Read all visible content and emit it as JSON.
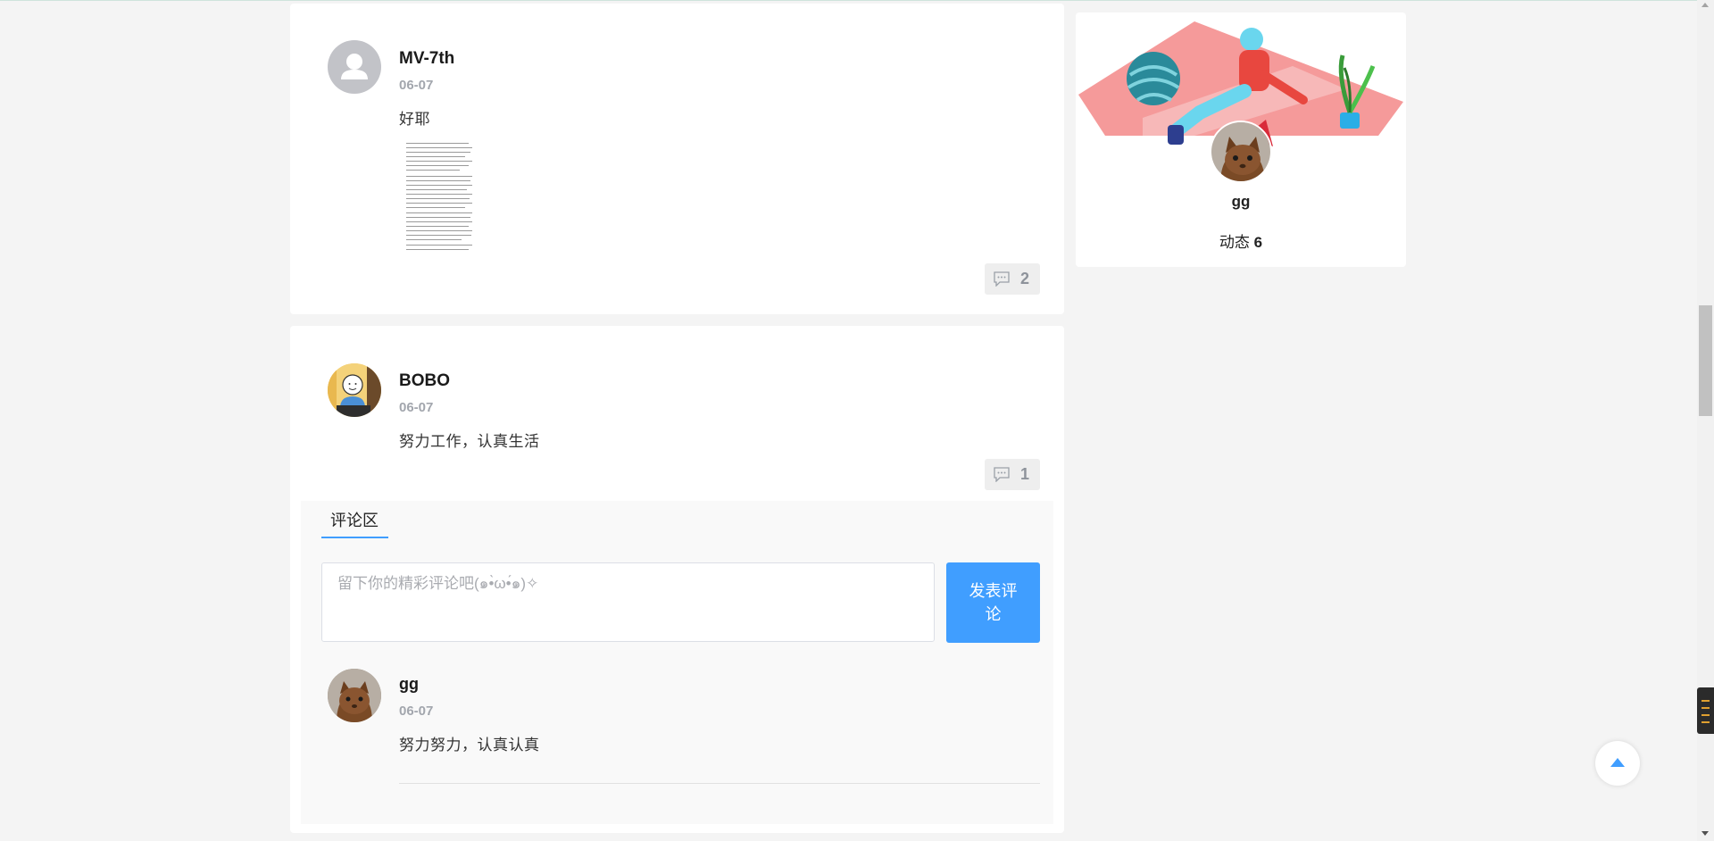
{
  "feed": {
    "posts": [
      {
        "author": "MV-7th",
        "date": "06-07",
        "text": "好耶",
        "comment_count": "2",
        "avatar_icon": "default-user-icon",
        "has_image": true
      },
      {
        "author": "BOBO",
        "date": "06-07",
        "text": "努力工作，认真生活",
        "comment_count": "1",
        "avatar_icon": "cartoon-avatar"
      }
    ]
  },
  "comment_section": {
    "tab_label": "评论区",
    "input_placeholder": "留下你的精彩评论吧(๑•̀ω•́๑)✧",
    "submit_label": "发表评论",
    "comments": [
      {
        "author": "gg",
        "date": "06-07",
        "text": "努力努力，认真认真"
      }
    ]
  },
  "profile": {
    "name": "gg",
    "stat_label": "动态",
    "stat_value": "6"
  },
  "colors": {
    "accent": "#409eff",
    "date_gray": "#a2a6ad",
    "page_bg": "#f4f4f4",
    "banner_pink": "#f59a9a"
  },
  "icons": {
    "comment": "comment-icon",
    "back_to_top": "caret-up-icon"
  }
}
